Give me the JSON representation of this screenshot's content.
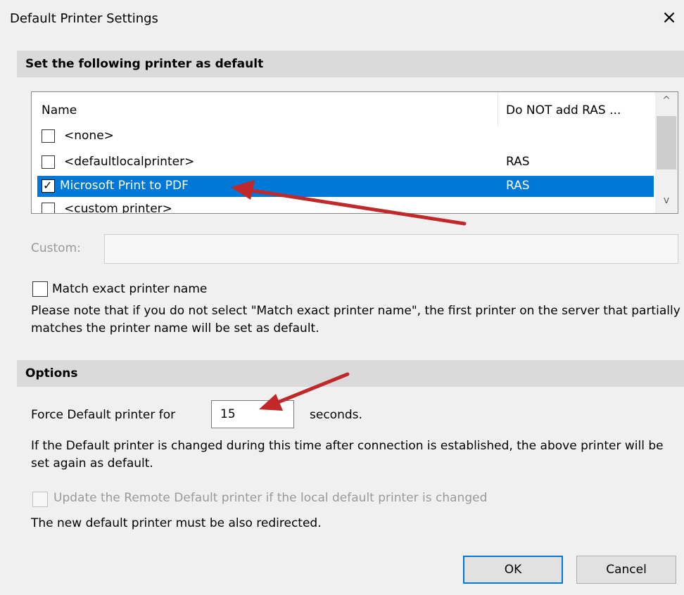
{
  "window": {
    "title": "Default Printer Settings",
    "close_glyph": "×"
  },
  "section_printer": {
    "header": "Set the following printer as default"
  },
  "printer_list": {
    "columns": [
      "Name",
      "Do NOT add RAS ..."
    ],
    "rows": [
      {
        "name": "<none>",
        "ras": "",
        "checked": false,
        "selected": false
      },
      {
        "name": "<defaultlocalprinter>",
        "ras": "RAS",
        "checked": false,
        "selected": false
      },
      {
        "name": "Microsoft Print to PDF",
        "ras": "RAS",
        "checked": true,
        "selected": true
      },
      {
        "name": "<custom printer>",
        "ras": "",
        "checked": false,
        "selected": false
      }
    ],
    "scroll_up_glyph": "^",
    "scroll_down_glyph": "v",
    "check_glyph": "✓",
    "selection_color": "#0078d7"
  },
  "custom": {
    "label": "Custom:",
    "value": ""
  },
  "match_exact": {
    "label": "Match exact printer name",
    "checked": false,
    "note": "Please note that if you do not select \"Match exact printer name\",  the first printer on the server that partially matches the printer name will be set as default."
  },
  "section_options": {
    "header": "Options"
  },
  "force_default": {
    "label": "Force Default printer for",
    "value": "15",
    "unit": "seconds.",
    "note": "If the Default printer is changed during this time after connection is established, the above printer will be set again as default."
  },
  "update_remote": {
    "label": "Update the Remote Default printer if the local default printer is changed",
    "checked": false,
    "note": "The new default printer must be also redirected."
  },
  "buttons": {
    "ok": "OK",
    "cancel": "Cancel"
  },
  "annotation_color": "#c0282a"
}
